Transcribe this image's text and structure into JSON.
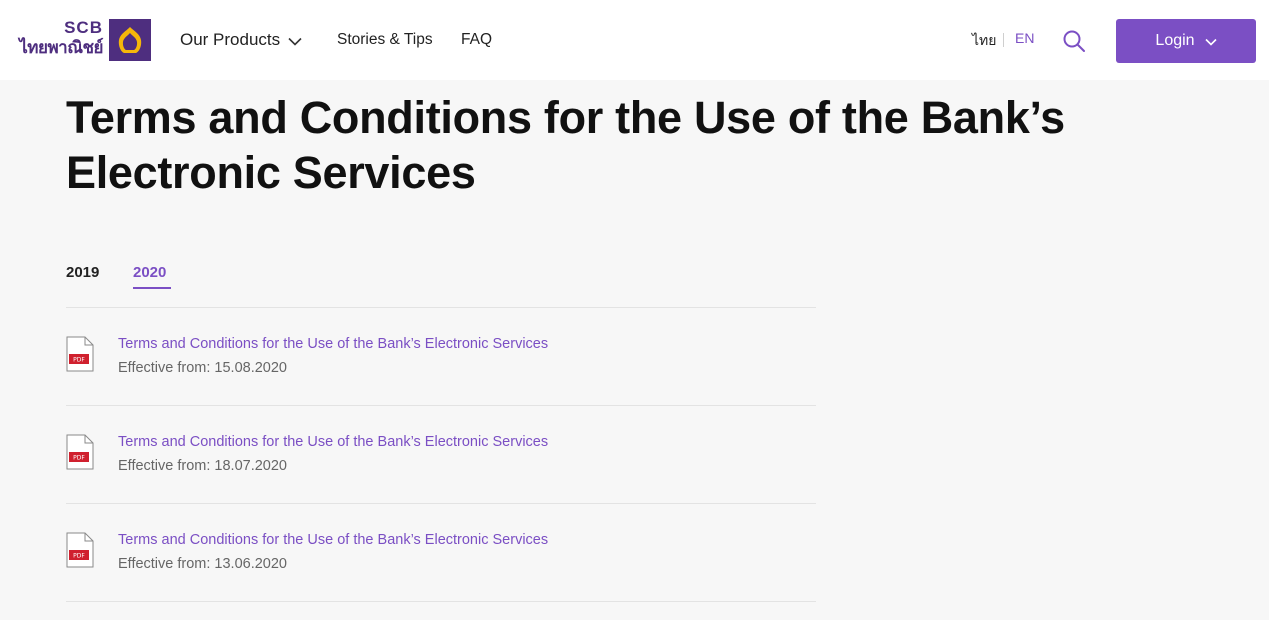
{
  "brand": {
    "name_en": "SCB",
    "name_th": "ไทยพาณิชย์",
    "color": "#4e2e7f",
    "accent": "#7b4fc4",
    "logo_icon": "scb-emblem-icon"
  },
  "nav": {
    "products_label": "Our Products",
    "stories_label": "Stories & Tips",
    "faq_label": "FAQ",
    "products_icon": "chevron-down-icon"
  },
  "language": {
    "thai_label": "ไทย",
    "english_label": "EN",
    "active": "EN"
  },
  "header_actions": {
    "search_icon": "search-icon",
    "login_label": "Login",
    "login_icon": "chevron-down-icon"
  },
  "page": {
    "title": "Terms and Conditions for the Use of the Bank’s Electronic Services"
  },
  "tabs": [
    {
      "label": "2019",
      "active": false
    },
    {
      "label": "2020",
      "active": true
    }
  ],
  "documents": [
    {
      "title": "Terms and Conditions for the Use of the Bank’s Electronic Services",
      "effective": "Effective from: 15.08.2020",
      "icon": "pdf-file-icon",
      "icon_label": "PDF"
    },
    {
      "title": "Terms and Conditions for the Use of the Bank’s Electronic Services",
      "effective": "Effective from: 18.07.2020",
      "icon": "pdf-file-icon",
      "icon_label": "PDF"
    },
    {
      "title": "Terms and Conditions for the Use of the Bank’s Electronic Services",
      "effective": "Effective from: 13.06.2020",
      "icon": "pdf-file-icon",
      "icon_label": "PDF"
    }
  ]
}
